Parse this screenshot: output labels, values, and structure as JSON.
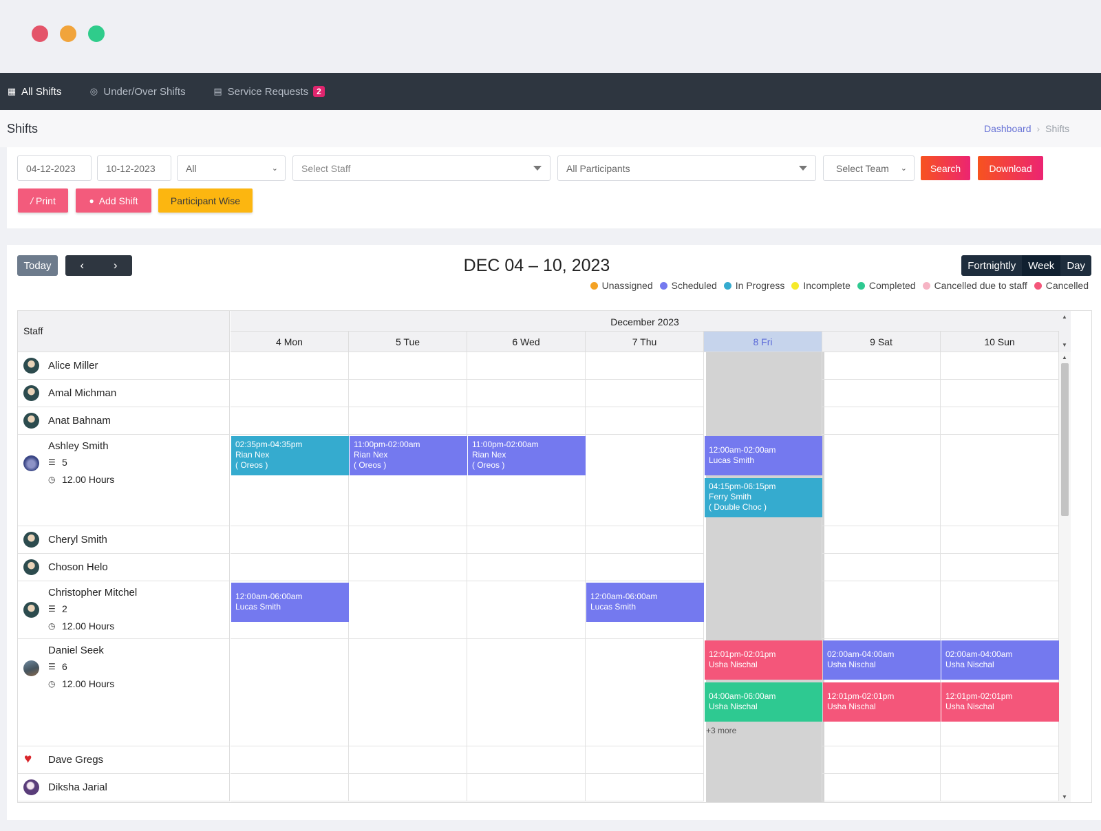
{
  "nav": {
    "items": [
      {
        "label": "All Shifts",
        "icon": "grid-icon"
      },
      {
        "label": "Under/Over Shifts",
        "icon": "check-circle-icon"
      },
      {
        "label": "Service Requests",
        "icon": "clipboard-icon",
        "badge": "2"
      }
    ]
  },
  "page": {
    "title": "Shifts",
    "breadcrumb": [
      "Dashboard",
      "Shifts"
    ]
  },
  "filters": {
    "start_date": "04-12-2023",
    "end_date": "10-12-2023",
    "status_select": "All",
    "staff_placeholder": "Select Staff",
    "participants_select": "All Participants",
    "team_placeholder": "Select Team",
    "search_label": "Search",
    "download_label": "Download",
    "print_label": "Print",
    "add_shift_label": "Add Shift",
    "participant_wise_label": "Participant Wise"
  },
  "calendar": {
    "today_label": "Today",
    "prev": "‹",
    "next": "›",
    "title": "DEC 04 – 10, 2023",
    "views": [
      "Fortnightly",
      "Week",
      "Day"
    ],
    "active_view": "Week",
    "legend": [
      {
        "label": "Unassigned",
        "color": "#f4a224"
      },
      {
        "label": "Scheduled",
        "color": "#7479ef"
      },
      {
        "label": "In Progress",
        "color": "#35abcf"
      },
      {
        "label": "Incomplete",
        "color": "#f6ea2a"
      },
      {
        "label": "Completed",
        "color": "#2ec991"
      },
      {
        "label": "Cancelled due to staff",
        "color": "#f6b4c4"
      },
      {
        "label": "Cancelled",
        "color": "#f4567a"
      }
    ],
    "staff_header": "Staff",
    "month": "December 2023",
    "days": [
      "4 Mon",
      "5 Tue",
      "6 Wed",
      "7 Thu",
      "8 Fri",
      "9 Sat",
      "10 Sun"
    ],
    "today_index": 4,
    "staff": [
      {
        "name": "Alice Miller",
        "avatar": "man"
      },
      {
        "name": "Amal Michman",
        "avatar": "man"
      },
      {
        "name": "Anat Bahnam",
        "avatar": "man"
      },
      {
        "name": "Ashley Smith",
        "avatar": "water",
        "shifts": "5",
        "hours": "12.00 Hours"
      },
      {
        "name": "Cheryl Smith",
        "avatar": "man"
      },
      {
        "name": "Choson Helo",
        "avatar": "man"
      },
      {
        "name": "Christopher Mitchel",
        "avatar": "man",
        "shifts": "2",
        "hours": "12.00 Hours"
      },
      {
        "name": "Daniel Seek",
        "avatar": "land",
        "shifts": "6",
        "hours": "12.00 Hours"
      },
      {
        "name": "Dave Gregs",
        "avatar": "heart"
      },
      {
        "name": "Diksha Jarial",
        "avatar": "purple"
      }
    ],
    "events": [
      {
        "row": 3,
        "day": 0,
        "slot": 0,
        "status": "inprogress",
        "time": "02:35pm-04:35pm",
        "participant": "Rian Nex",
        "note": "( Oreos )"
      },
      {
        "row": 3,
        "day": 1,
        "slot": 0,
        "status": "scheduled",
        "time": "11:00pm-02:00am",
        "participant": "Rian Nex",
        "note": "( Oreos )"
      },
      {
        "row": 3,
        "day": 2,
        "slot": 0,
        "status": "scheduled",
        "time": "11:00pm-02:00am",
        "participant": "Rian Nex",
        "note": "( Oreos )"
      },
      {
        "row": 3,
        "day": 4,
        "slot": 0,
        "status": "scheduled",
        "time": "12:00am-02:00am",
        "participant": "Lucas Smith",
        "note": ""
      },
      {
        "row": 3,
        "day": 4,
        "slot": 1,
        "status": "inprogress",
        "time": "04:15pm-06:15pm",
        "participant": "Ferry Smith",
        "note": "( Double Choc )"
      },
      {
        "row": 6,
        "day": 0,
        "slot": 0,
        "status": "scheduled",
        "time": "12:00am-06:00am",
        "participant": "Lucas Smith",
        "note": ""
      },
      {
        "row": 6,
        "day": 3,
        "slot": 0,
        "status": "scheduled",
        "time": "12:00am-06:00am",
        "participant": "Lucas Smith",
        "note": ""
      },
      {
        "row": 7,
        "day": 4,
        "slot": 0,
        "status": "cancelled",
        "time": "12:01pm-02:01pm",
        "participant": "Usha Nischal",
        "note": ""
      },
      {
        "row": 7,
        "day": 4,
        "slot": 1,
        "status": "completed",
        "time": "04:00am-06:00am",
        "participant": "Usha Nischal",
        "note": ""
      },
      {
        "row": 7,
        "day": 5,
        "slot": 0,
        "status": "scheduled",
        "time": "02:00am-04:00am",
        "participant": "Usha Nischal",
        "note": ""
      },
      {
        "row": 7,
        "day": 5,
        "slot": 1,
        "status": "cancelled",
        "time": "12:01pm-02:01pm",
        "participant": "Usha Nischal",
        "note": ""
      },
      {
        "row": 7,
        "day": 6,
        "slot": 0,
        "status": "scheduled",
        "time": "02:00am-04:00am",
        "participant": "Usha Nischal",
        "note": ""
      },
      {
        "row": 7,
        "day": 6,
        "slot": 1,
        "status": "cancelled",
        "time": "12:01pm-02:01pm",
        "participant": "Usha Nischal",
        "note": ""
      }
    ],
    "more": [
      {
        "row": 7,
        "day": 4,
        "label": "+3 more"
      }
    ]
  }
}
